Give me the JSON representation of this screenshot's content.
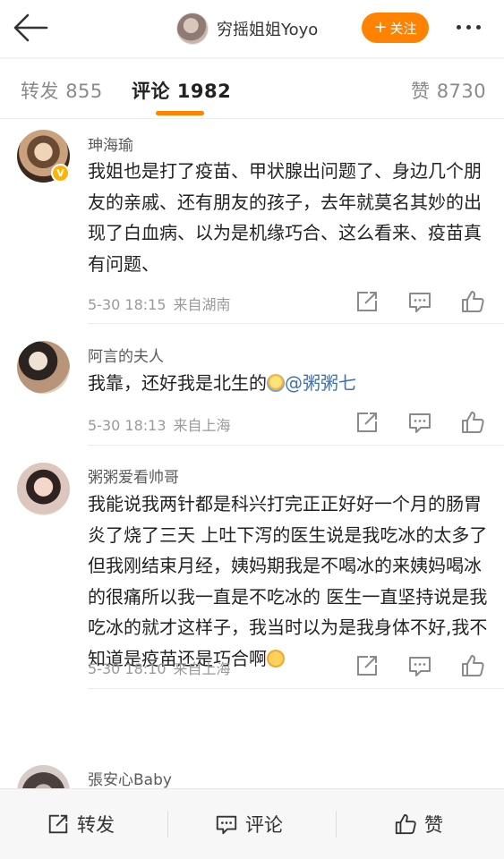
{
  "header": {
    "username": "穷摇姐姐Yoyo",
    "follow_label": "关注",
    "follow_plus": "+",
    "accent_color": "#ff8200"
  },
  "tabs": [
    {
      "label": "转发",
      "count": "855",
      "active": false
    },
    {
      "label": "评论",
      "count": "1982",
      "active": true
    },
    {
      "label": "赞",
      "count": "8730",
      "active": false
    }
  ],
  "comments": [
    {
      "name": "珅海瑜",
      "verified": true,
      "text": "我姐也是打了疫苗、甲状腺出问题了、身边几个朋友的亲戚、还有朋友的孩子，去年就莫名其妙的出现了白血病、以为是机缘巧合、这么看来、疫苗真有问题、",
      "time": "5-30 18:15",
      "source": "来自湖南"
    },
    {
      "name": "阿言的夫人",
      "verified": false,
      "text": "我靠，还好我是北生的",
      "emoji": "pray-icon",
      "mention": "@粥粥七",
      "time": "5-30 18:13",
      "source": "来自上海"
    },
    {
      "name": "粥粥爱看帅哥",
      "verified": false,
      "text": "我能说我两针都是科兴打完正正好好一个月的肠胃炎了烧了三天 上吐下泻的医生说是我吃冰的太多了但我刚结束月经，姨妈期我是不喝冰的来姨妈喝冰的很痛所以我一直是不吃冰的 医生一直坚持说是我吃冰的就才这样子，我当时以为是我身体不好,我不知道是疫苗还是巧合啊",
      "emoji": "crying-face-icon",
      "time": "5-30 18:10",
      "source": "来自上海"
    },
    {
      "name": "張安心Baby",
      "verified": false
    }
  ],
  "bottom_bar": {
    "repost_label": "转发",
    "comment_label": "评论",
    "like_label": "赞"
  },
  "icons": {
    "back": "arrow-left-icon",
    "more": "more-dots-icon",
    "repost": "repost-icon",
    "comment": "comment-icon",
    "like": "thumbs-up-icon",
    "verified": "verified-badge-icon"
  }
}
